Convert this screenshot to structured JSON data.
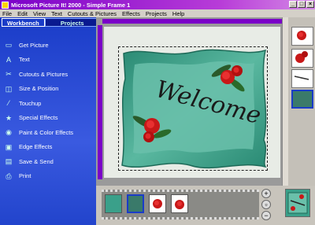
{
  "window": {
    "title": "Microsoft Picture It! 2000 - Simple Frame 1",
    "controls": [
      "_",
      "□",
      "×"
    ]
  },
  "menu": [
    "File",
    "Edit",
    "View",
    "Text",
    "Cutouts & Pictures",
    "Effects",
    "Projects",
    "Help"
  ],
  "left_panel": {
    "tabs": [
      "Workbench",
      "Projects"
    ],
    "items": [
      {
        "label": "Get Picture",
        "icon": "get-picture-icon"
      },
      {
        "label": "Text",
        "icon": "text-icon"
      },
      {
        "label": "Cutouts & Pictures",
        "icon": "scissors-icon"
      },
      {
        "label": "Size & Position",
        "icon": "size-position-icon"
      },
      {
        "label": "Touchup",
        "icon": "touchup-icon"
      },
      {
        "label": "Special Effects",
        "icon": "special-effects-icon"
      },
      {
        "label": "Paint & Color Effects",
        "icon": "paint-palette-icon"
      },
      {
        "label": "Edge Effects",
        "icon": "edge-effects-icon"
      },
      {
        "label": "Save & Send",
        "icon": "save-icon"
      },
      {
        "label": "Print",
        "icon": "print-icon"
      }
    ]
  },
  "canvas": {
    "frame_text": "Welcome",
    "frame_color": "#3aa08a",
    "accent": "#7a00c8"
  },
  "gallery": {
    "thumbnails": [
      "roses",
      "roses",
      "welcome-text",
      "selected-frame"
    ]
  },
  "filmstrip": {
    "thumbnails": [
      "frame-preview",
      "selected",
      "roses",
      "roses"
    ]
  },
  "colors": {
    "titlebar": "#7a00c8",
    "left_panel": "#1a3cc8",
    "text": "#ffffff"
  }
}
